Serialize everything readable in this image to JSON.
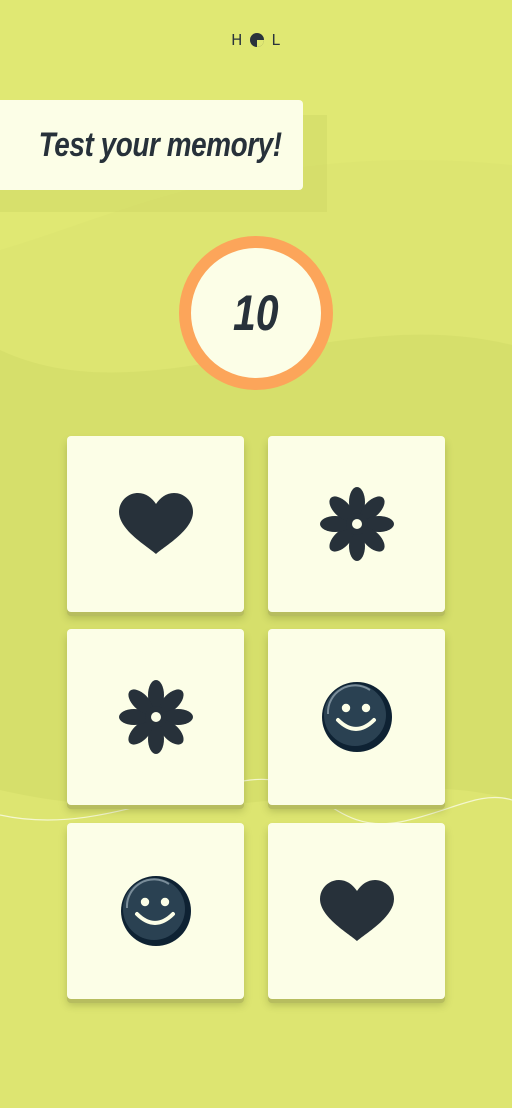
{
  "logo": {
    "left_letter": "H",
    "right_letter": "L"
  },
  "title": "Test your memory!",
  "counter": {
    "value": "10"
  },
  "cards": [
    {
      "icon": "heart-icon"
    },
    {
      "icon": "flower-icon"
    },
    {
      "icon": "flower-icon"
    },
    {
      "icon": "smiley-icon"
    },
    {
      "icon": "smiley-icon"
    },
    {
      "icon": "heart-icon"
    }
  ],
  "colors": {
    "background": "#e0e873",
    "background_band": "#d5dd6a",
    "card": "#fcfee7",
    "counter_ring": "#fca55a",
    "ink": "#27313a"
  }
}
